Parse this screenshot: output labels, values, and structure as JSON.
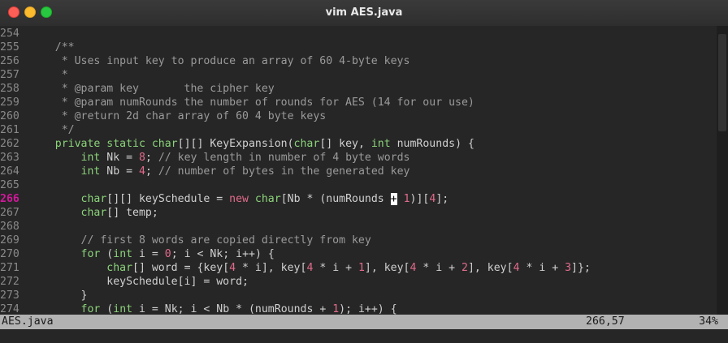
{
  "window": {
    "title": "vim AES.java"
  },
  "editor": {
    "lines": [
      {
        "num": "254",
        "segs": []
      },
      {
        "num": "255",
        "segs": [
          [
            "c",
            "    /**"
          ]
        ]
      },
      {
        "num": "256",
        "segs": [
          [
            "c",
            "     * Uses input key to produce an array of 60 4-byte keys"
          ]
        ]
      },
      {
        "num": "257",
        "segs": [
          [
            "c",
            "     *"
          ]
        ]
      },
      {
        "num": "258",
        "segs": [
          [
            "c",
            "     * @param key       the cipher key"
          ]
        ]
      },
      {
        "num": "259",
        "segs": [
          [
            "c",
            "     * @param numRounds the number of rounds for AES (14 for our use)"
          ]
        ]
      },
      {
        "num": "260",
        "segs": [
          [
            "c",
            "     * @return 2d char array of 60 4 byte keys"
          ]
        ]
      },
      {
        "num": "261",
        "segs": [
          [
            "c",
            "     */"
          ]
        ]
      },
      {
        "num": "262",
        "segs": [
          [
            "p",
            "    "
          ],
          [
            "k",
            "private static "
          ],
          [
            "t",
            "char"
          ],
          [
            "p",
            "[][] KeyExpansion("
          ],
          [
            "t",
            "char"
          ],
          [
            "p",
            "[] key, "
          ],
          [
            "t",
            "int"
          ],
          [
            "p",
            " numRounds) {"
          ]
        ]
      },
      {
        "num": "263",
        "segs": [
          [
            "p",
            "        "
          ],
          [
            "t",
            "int"
          ],
          [
            "p",
            " Nk = "
          ],
          [
            "n",
            "8"
          ],
          [
            "p",
            "; "
          ],
          [
            "c",
            "// key length in number of 4 byte words"
          ]
        ]
      },
      {
        "num": "264",
        "segs": [
          [
            "p",
            "        "
          ],
          [
            "t",
            "int"
          ],
          [
            "p",
            " Nb = "
          ],
          [
            "n",
            "4"
          ],
          [
            "p",
            "; "
          ],
          [
            "c",
            "// number of bytes in the generated key"
          ]
        ]
      },
      {
        "num": "265",
        "segs": []
      },
      {
        "num": "266",
        "current": true,
        "segs": [
          [
            "p",
            "        "
          ],
          [
            "t",
            "char"
          ],
          [
            "p",
            "[][] keySchedule = "
          ],
          [
            "n",
            "new "
          ],
          [
            "t",
            "char"
          ],
          [
            "p",
            "[Nb * (numRounds "
          ],
          [
            "cur",
            "+"
          ],
          [
            "p",
            " "
          ],
          [
            "n",
            "1"
          ],
          [
            "p",
            ")]["
          ],
          [
            "n",
            "4"
          ],
          [
            "p",
            "];"
          ]
        ]
      },
      {
        "num": "267",
        "segs": [
          [
            "p",
            "        "
          ],
          [
            "t",
            "char"
          ],
          [
            "p",
            "[] temp;"
          ]
        ]
      },
      {
        "num": "268",
        "segs": []
      },
      {
        "num": "269",
        "segs": [
          [
            "p",
            "        "
          ],
          [
            "c",
            "// first 8 words are copied directly from key"
          ]
        ]
      },
      {
        "num": "270",
        "segs": [
          [
            "p",
            "        "
          ],
          [
            "k",
            "for"
          ],
          [
            "p",
            " ("
          ],
          [
            "t",
            "int"
          ],
          [
            "p",
            " i = "
          ],
          [
            "n",
            "0"
          ],
          [
            "p",
            "; i < Nk; i++) {"
          ]
        ]
      },
      {
        "num": "271",
        "segs": [
          [
            "p",
            "            "
          ],
          [
            "t",
            "char"
          ],
          [
            "p",
            "[] word = {key["
          ],
          [
            "n",
            "4"
          ],
          [
            "p",
            " * i], key["
          ],
          [
            "n",
            "4"
          ],
          [
            "p",
            " * i + "
          ],
          [
            "n",
            "1"
          ],
          [
            "p",
            "], key["
          ],
          [
            "n",
            "4"
          ],
          [
            "p",
            " * i + "
          ],
          [
            "n",
            "2"
          ],
          [
            "p",
            "], key["
          ],
          [
            "n",
            "4"
          ],
          [
            "p",
            " * i + "
          ],
          [
            "n",
            "3"
          ],
          [
            "p",
            "]};"
          ]
        ]
      },
      {
        "num": "272",
        "segs": [
          [
            "p",
            "            keySchedule[i] = word;"
          ]
        ]
      },
      {
        "num": "273",
        "segs": [
          [
            "p",
            "        }"
          ]
        ]
      },
      {
        "num": "274",
        "segs": [
          [
            "p",
            "        "
          ],
          [
            "k",
            "for"
          ],
          [
            "p",
            " ("
          ],
          [
            "t",
            "int"
          ],
          [
            "p",
            " i = Nk; i < Nb * (numRounds + "
          ],
          [
            "n",
            "1"
          ],
          [
            "p",
            "); i++) {"
          ]
        ]
      }
    ]
  },
  "statusline": {
    "filename": "AES.java",
    "position": "266,57",
    "percent": "34%"
  }
}
